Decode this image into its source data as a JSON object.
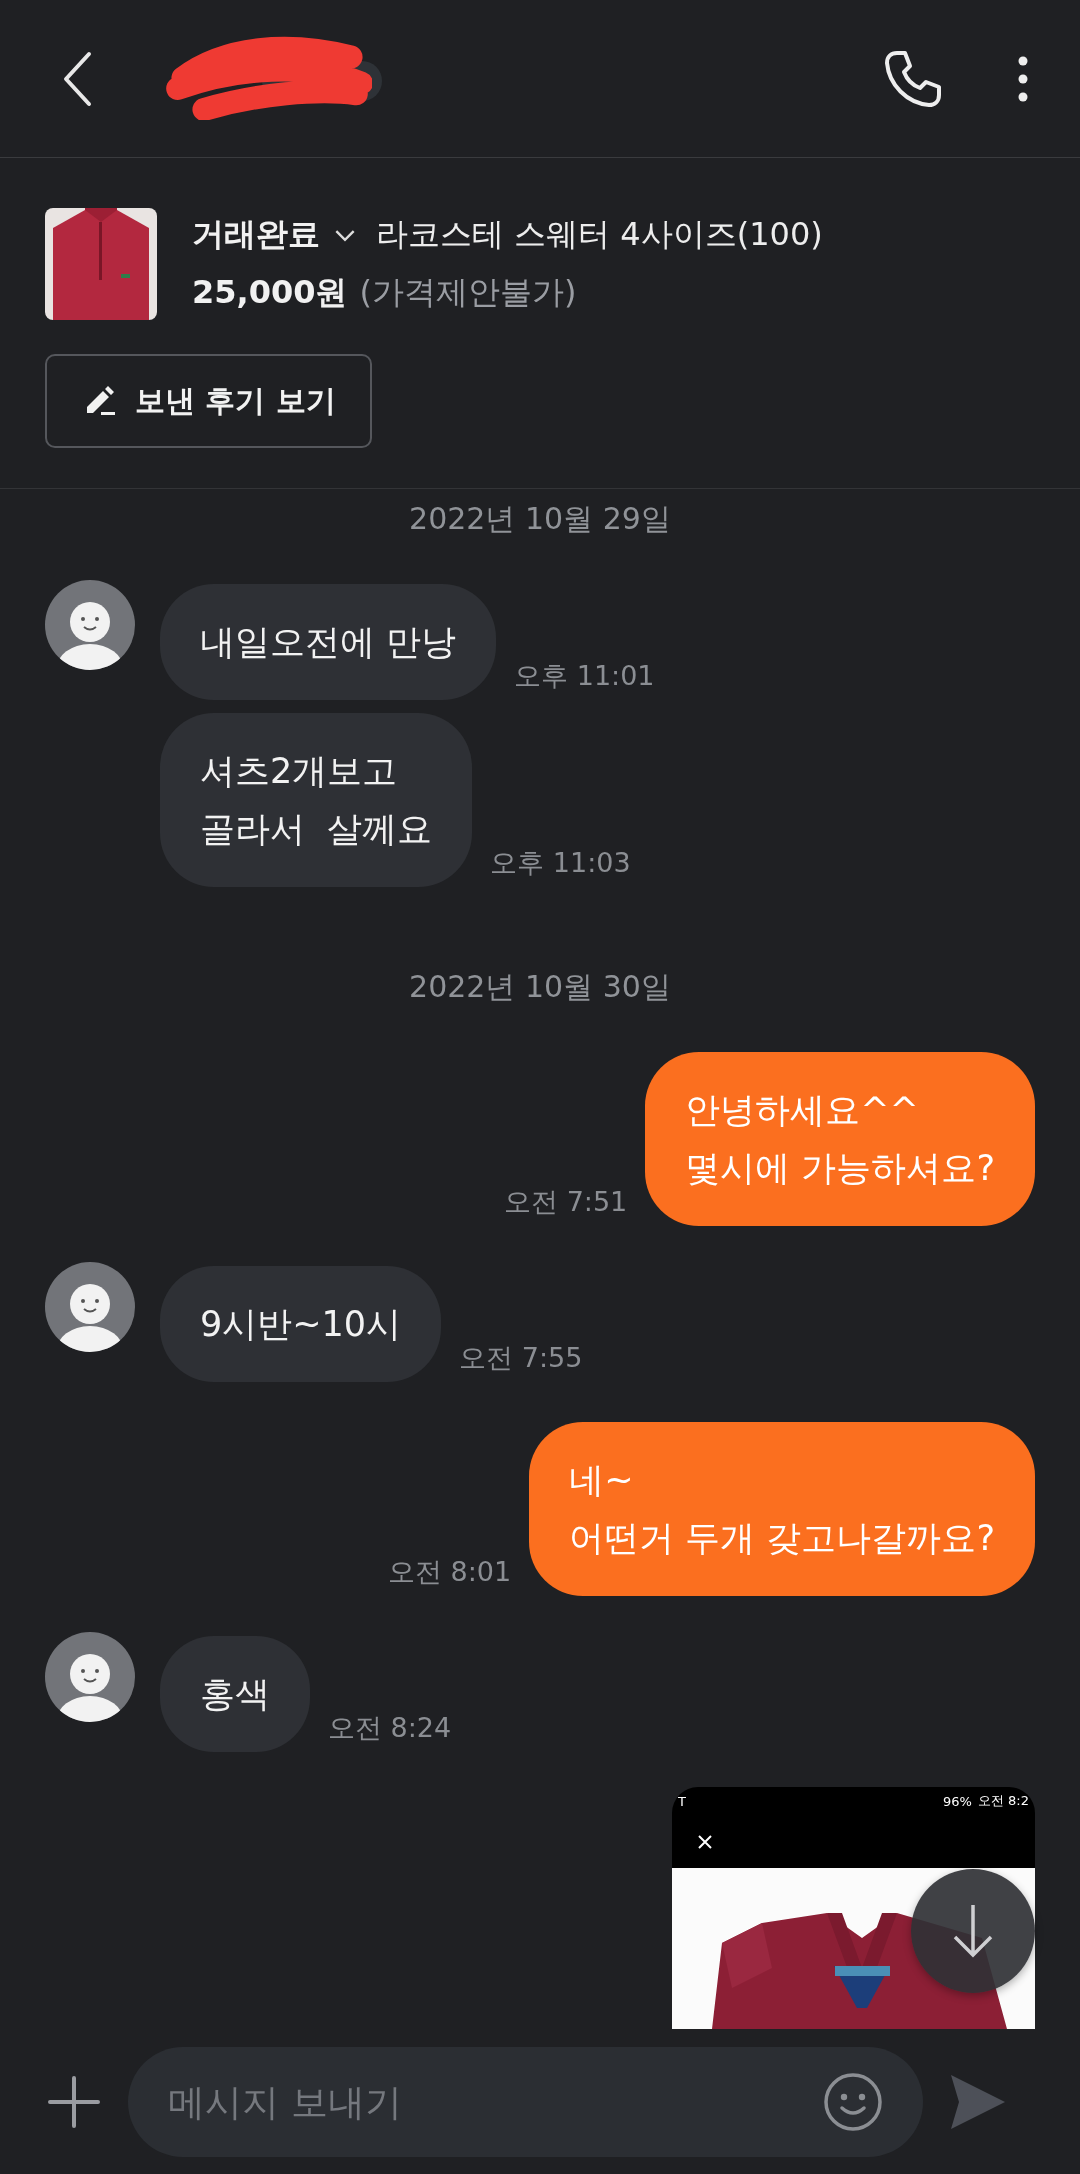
{
  "product": {
    "status": "거래완료",
    "title": "라코스테 스웨터 4사이즈(100)",
    "price": "25,000원",
    "price_note": "(가격제안불가)",
    "review_button": "보낸 후기 보기"
  },
  "messages": [
    {
      "kind": "date",
      "text": "2022년 10월 29일"
    },
    {
      "kind": "received",
      "avatar": true,
      "text": "내일오전에 만낭",
      "time": "오후 11:01"
    },
    {
      "kind": "received",
      "avatar": false,
      "text": "셔츠2개보고\n골라서  살께요",
      "time": "오후 11:03"
    },
    {
      "kind": "date",
      "text": "2022년 10월 30일"
    },
    {
      "kind": "sent",
      "text": "안녕하세요^^\n몇시에 가능하셔요?",
      "time": "오전 7:51"
    },
    {
      "kind": "received",
      "avatar": true,
      "text": "9시반~10시",
      "time": "오전 7:55"
    },
    {
      "kind": "sent",
      "text": "네~\n어떤거 두개 갖고나갈까요?",
      "time": "오전 8:01"
    },
    {
      "kind": "received",
      "avatar": true,
      "text": "홍색",
      "time": "오전 8:24"
    },
    {
      "carrier": "T",
      "battery": "96%",
      "clock": "오전 8:2"
    }
  ],
  "composer": {
    "placeholder": "메시지 보내기"
  }
}
